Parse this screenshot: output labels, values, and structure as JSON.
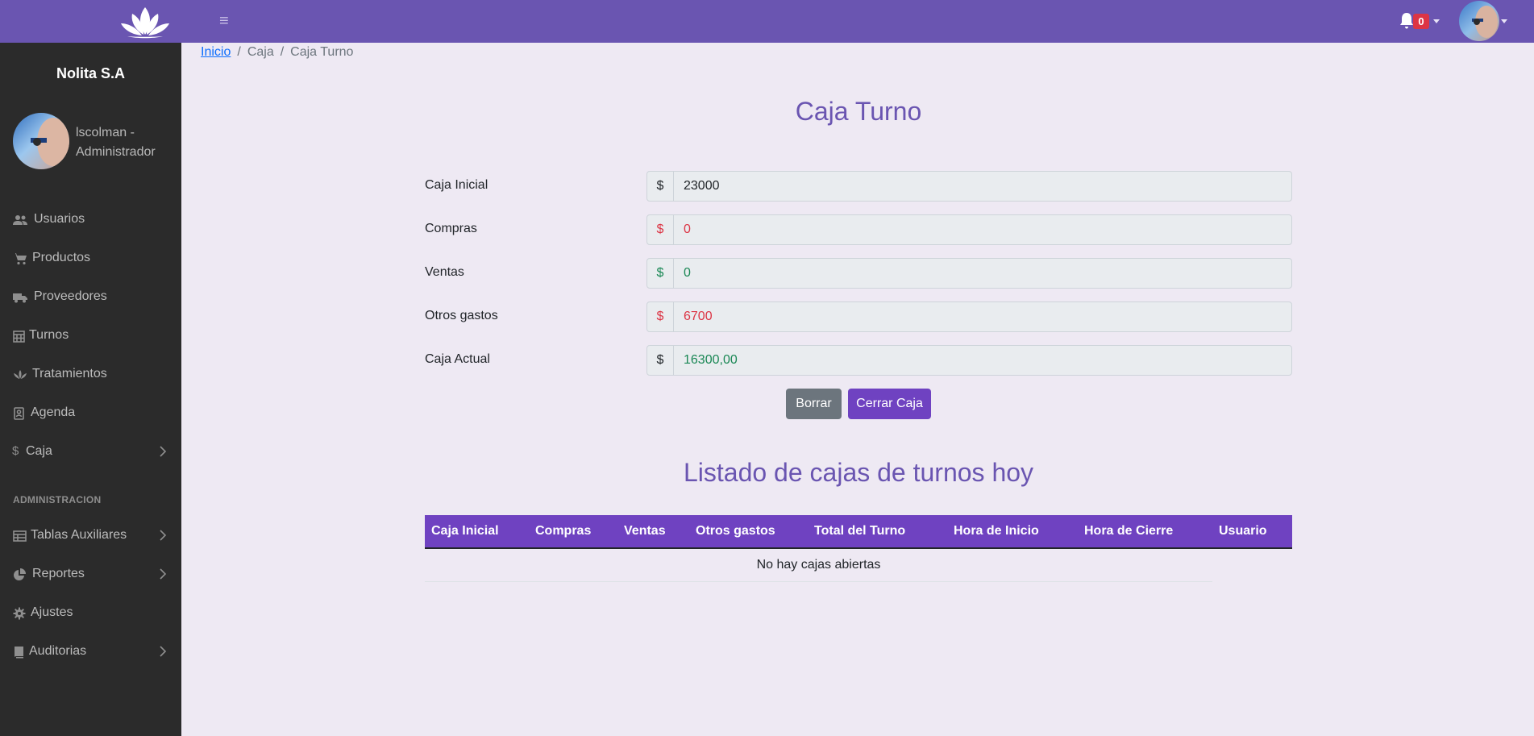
{
  "header": {
    "notifications_count": "0"
  },
  "sidebar": {
    "company": "Nolita S.A",
    "user_name": "lscolman - Administrador",
    "items": [
      {
        "label": "Usuarios",
        "icon": "users-icon",
        "has_submenu": false
      },
      {
        "label": "Productos",
        "icon": "cart-icon",
        "has_submenu": false
      },
      {
        "label": "Proveedores",
        "icon": "truck-icon",
        "has_submenu": false
      },
      {
        "label": "Turnos",
        "icon": "calendar-icon",
        "has_submenu": false
      },
      {
        "label": "Tratamientos",
        "icon": "spa-icon",
        "has_submenu": false
      },
      {
        "label": "Agenda",
        "icon": "address-book-icon",
        "has_submenu": false
      },
      {
        "label": "Caja",
        "icon": "dollar-icon",
        "has_submenu": true
      }
    ],
    "section_label": "ADMINISTRACION",
    "admin_items": [
      {
        "label": "Tablas Auxiliares",
        "icon": "table-icon",
        "has_submenu": true
      },
      {
        "label": "Reportes",
        "icon": "pie-chart-icon",
        "has_submenu": true
      },
      {
        "label": "Ajustes",
        "icon": "gear-icon",
        "has_submenu": false
      },
      {
        "label": "Auditorias",
        "icon": "book-icon",
        "has_submenu": true
      }
    ]
  },
  "breadcrumb": {
    "home": "Inicio",
    "level1": "Caja",
    "current": "Caja Turno",
    "separator": "/"
  },
  "main": {
    "title": "Caja Turno",
    "fields": [
      {
        "label": "Caja Inicial",
        "currency": "$",
        "value": "23000",
        "color": "#212529"
      },
      {
        "label": "Compras",
        "currency": "$",
        "value": "0",
        "color": "#dc3545"
      },
      {
        "label": "Ventas",
        "currency": "$",
        "value": "0",
        "color": "#198754"
      },
      {
        "label": "Otros gastos",
        "currency": "$",
        "value": "6700",
        "color": "#dc3545"
      },
      {
        "label": "Caja Actual",
        "currency": "$",
        "value": "16300,00",
        "color": "#198754"
      }
    ],
    "buttons": {
      "clear": "Borrar",
      "close": "Cerrar Caja"
    },
    "list_title": "Listado de cajas de turnos hoy",
    "table": {
      "columns": [
        "Caja Inicial",
        "Compras",
        "Ventas",
        "Otros gastos",
        "Total del Turno",
        "Hora de Inicio",
        "Hora de Cierre",
        "Usuario"
      ],
      "empty_message": "No hay cajas abiertas"
    }
  },
  "colors": {
    "topbar": "#6a55b1",
    "sidebar": "#2b2b2b",
    "accent": "#6f42c1",
    "title": "#6a55b1",
    "danger": "#dc3545",
    "success": "#198754",
    "secondary": "#6c757d"
  }
}
